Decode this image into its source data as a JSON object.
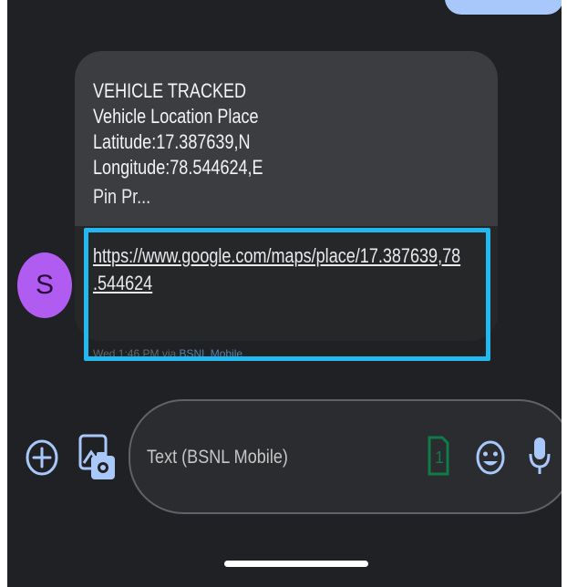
{
  "conversation": {
    "contact_initial": "S",
    "message": {
      "lines": [
        "VEHICLE TRACKED",
        "Vehicle Location Place",
        "Latitude:17.387639,N",
        "Longitude:78.544624,E",
        "Pin Pr..."
      ],
      "link_line1": "https://www.google.com/maps/place/17.387639,78",
      "link_line2": ".544624",
      "timestamp": "Wed 1:46 PM",
      "via": " via ",
      "sim": "BSNL Mobile"
    }
  },
  "composer": {
    "placeholder": "Text (BSNL Mobile)",
    "sim_slot": "1"
  },
  "colors": {
    "background": "#202124",
    "bubble": "#3c3d40",
    "avatar": "#b05cf0",
    "highlight": "#22b8f0",
    "sim_icon": "#0f7a4a",
    "icon": "#a8c7fa"
  }
}
